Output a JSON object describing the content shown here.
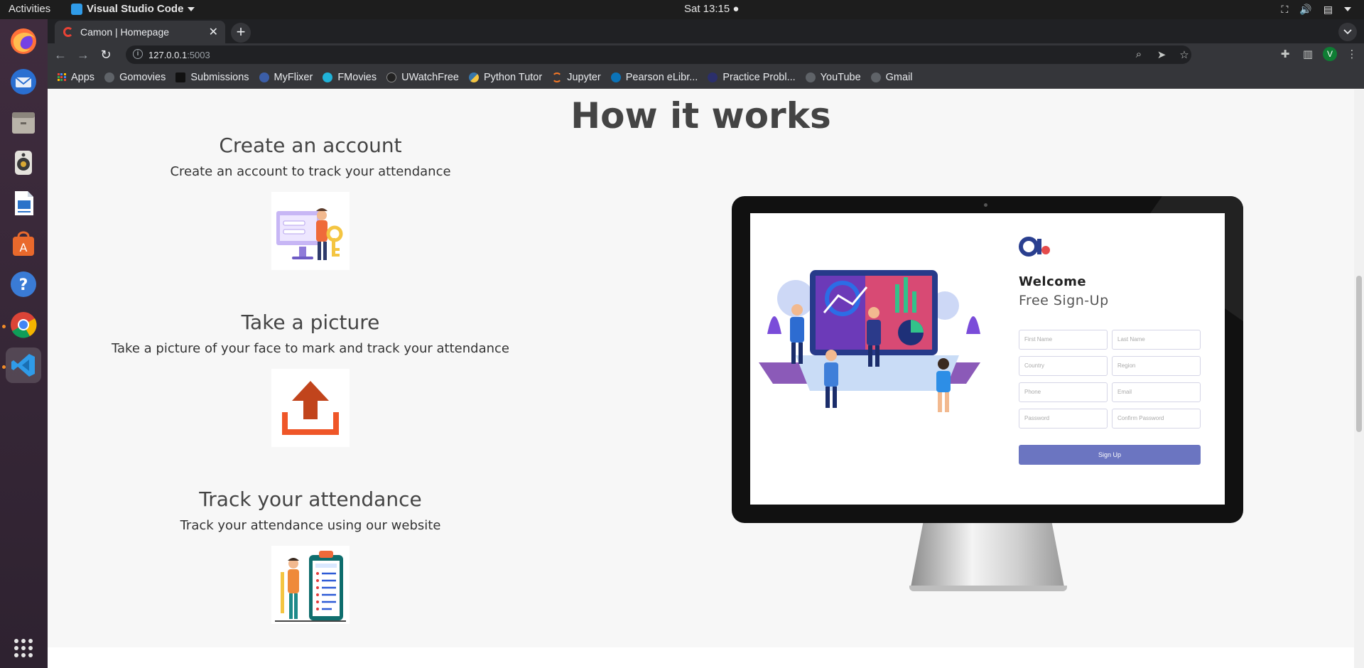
{
  "topbar": {
    "activities": "Activities",
    "app_name": "Visual Studio Code",
    "clock": "Sat 13:15"
  },
  "dock": {
    "items": [
      {
        "name": "Firefox",
        "color": "#ff7139"
      },
      {
        "name": "Thunderbird",
        "color": "#2a6fd1"
      },
      {
        "name": "Files",
        "color": "#c8c4bc"
      },
      {
        "name": "Rhythmbox",
        "color": "#d9a933"
      },
      {
        "name": "LibreOffice Writer",
        "color": "#2a73c9"
      },
      {
        "name": "Ubuntu Software",
        "color": "#e9692c"
      },
      {
        "name": "Help",
        "color": "#3a7bd5"
      },
      {
        "name": "Google Chrome",
        "color": "#4285f4"
      },
      {
        "name": "Visual Studio Code",
        "color": "#2f9be8"
      }
    ]
  },
  "browser": {
    "tab_title": "Camon | Homepage",
    "url_host": "127.0.0.1",
    "url_port": ":5003",
    "profile_initial": "V",
    "bookmarks": [
      {
        "label": "Apps",
        "color": "#e8eaed"
      },
      {
        "label": "Gomovies",
        "color": "#5f6368"
      },
      {
        "label": "Submissions",
        "color": "#111111"
      },
      {
        "label": "MyFlixer",
        "color": "#3b5ea8"
      },
      {
        "label": "FMovies",
        "color": "#20b2d8"
      },
      {
        "label": "UWatchFree",
        "color": "#222222"
      },
      {
        "label": "Python Tutor",
        "color": "#f4c542"
      },
      {
        "label": "Jupyter",
        "color": "#f37726"
      },
      {
        "label": "Pearson eLibr...",
        "color": "#0b73b8"
      },
      {
        "label": "Practice Probl...",
        "color": "#2b2f6b"
      },
      {
        "label": "YouTube",
        "color": "#5f6368"
      },
      {
        "label": "Gmail",
        "color": "#5f6368"
      }
    ]
  },
  "page": {
    "title": "How it works",
    "steps": [
      {
        "heading": "Create an account",
        "text": "Create an account to track your attendance"
      },
      {
        "heading": "Take a picture",
        "text": "Take a picture of your face to mark and track your attendance"
      },
      {
        "heading": "Track your attendance",
        "text": "Track your attendance using our website"
      }
    ],
    "signup_mock": {
      "welcome": "Welcome",
      "subtitle": "Free Sign-Up",
      "fields": [
        "First Name",
        "Last Name",
        "Country",
        "Region",
        "Phone",
        "Email",
        "Password",
        "Confirm Password"
      ],
      "button": "Sign Up",
      "accent": "#6b75c1"
    }
  }
}
